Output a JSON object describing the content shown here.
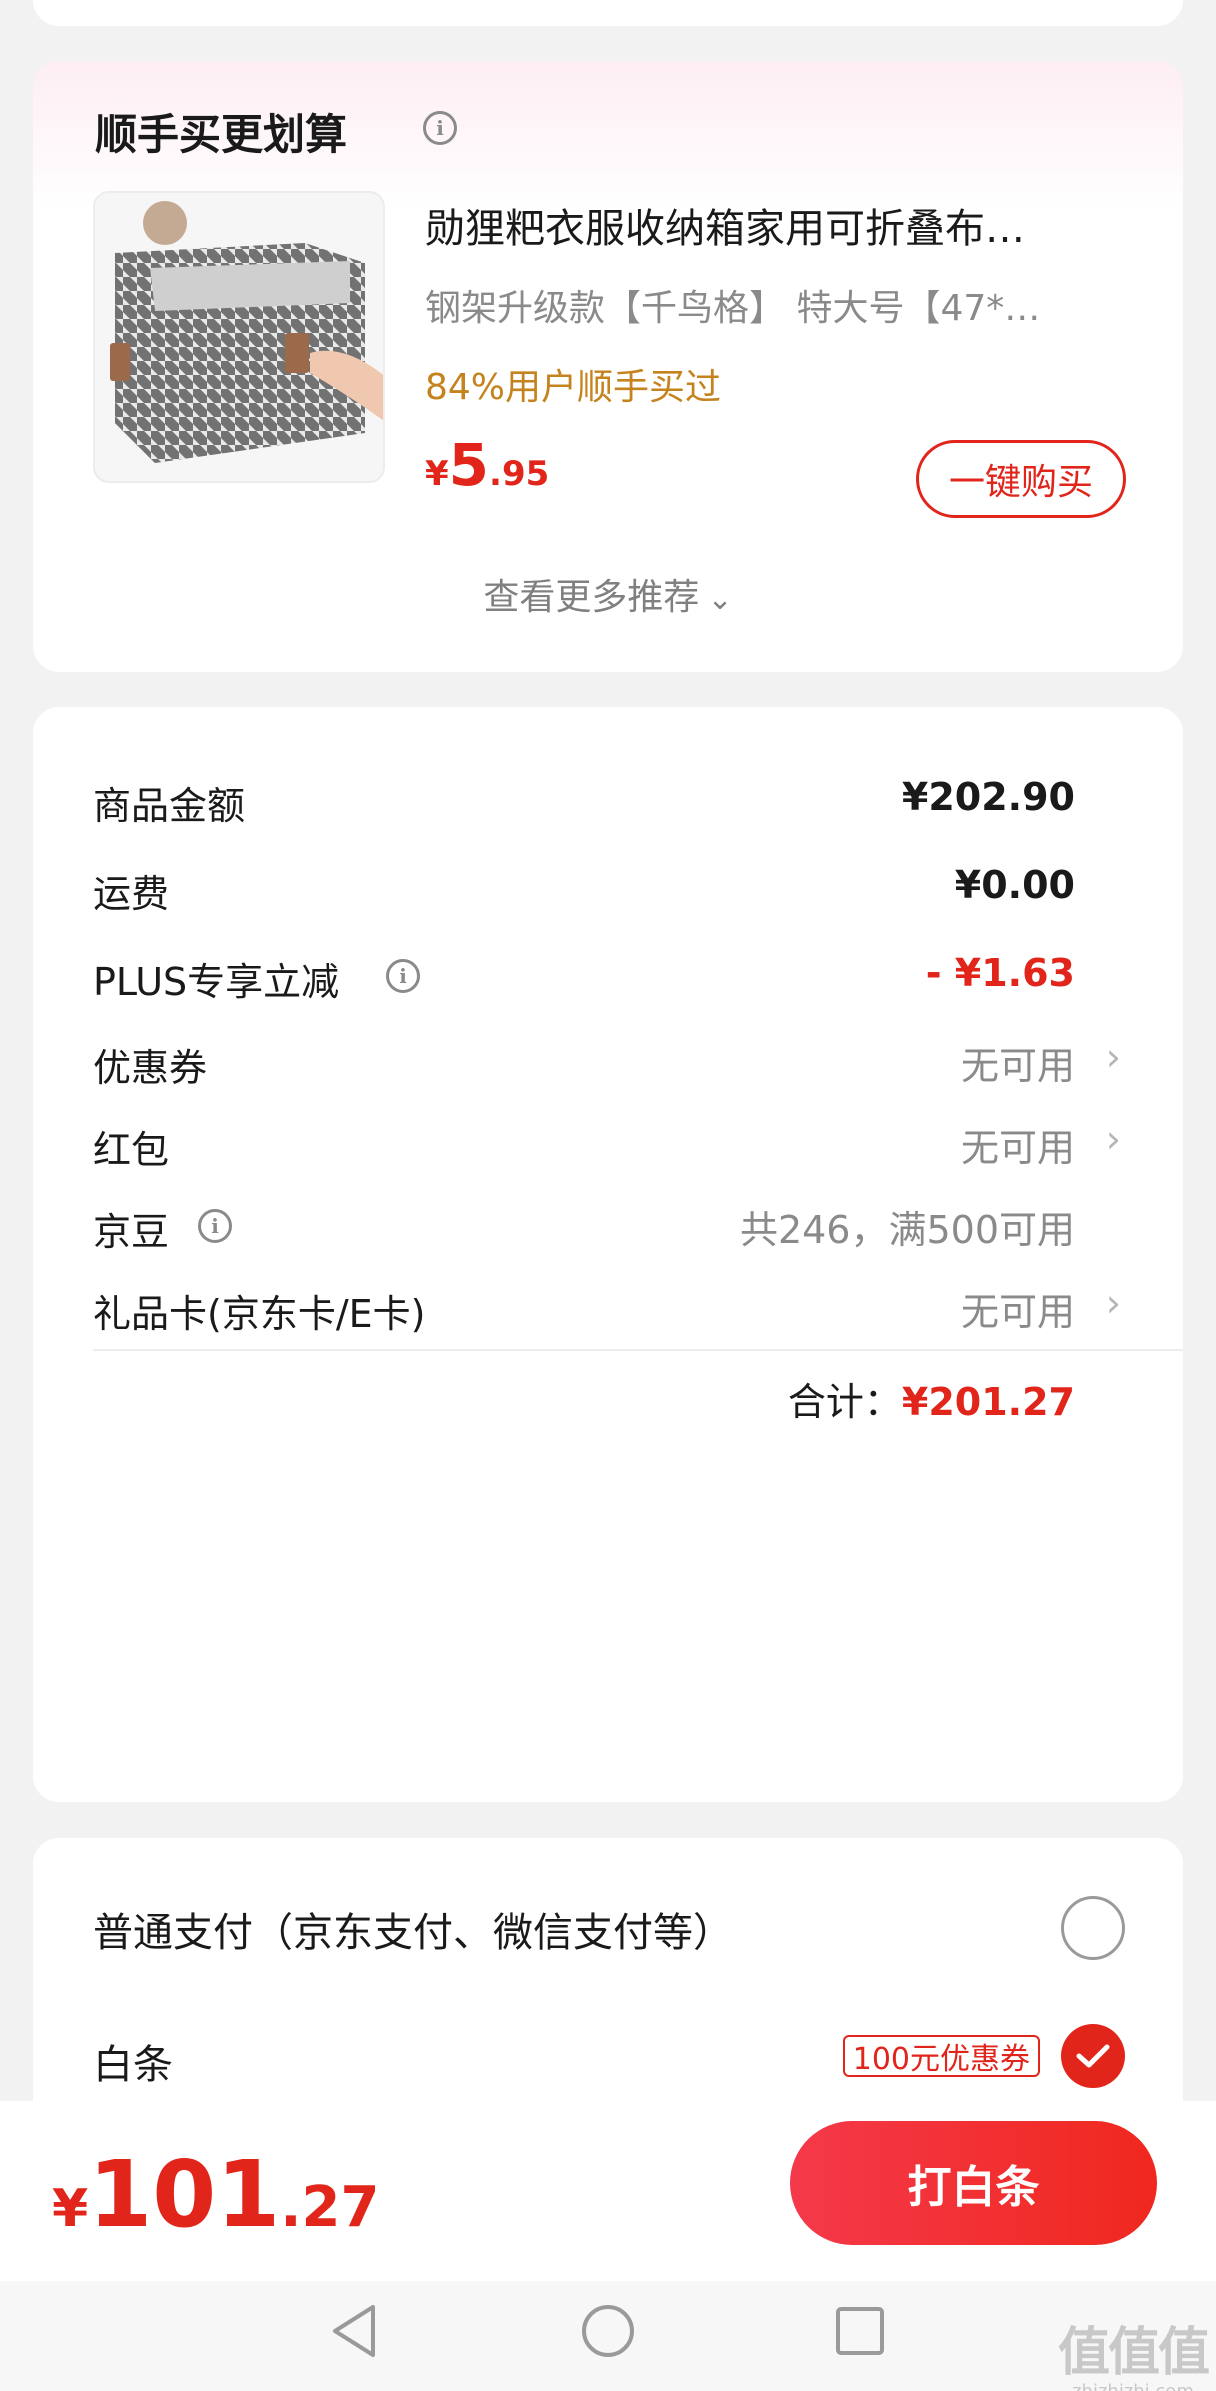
{
  "recommend": {
    "title": "顺手买更划算",
    "info_icon": "info-icon",
    "product": {
      "title": "勋狸粑衣服收纳箱家用可折叠布…",
      "spec": "钢架升级款【千鸟格】   特大号【47*…",
      "stat": "84%用户顺手买过",
      "price_symbol": "¥",
      "price_int": "5",
      "price_dec": ".95",
      "buy_label": "一键购买"
    },
    "more_label": "查看更多推荐"
  },
  "summary": {
    "rows": [
      {
        "label": "商品金额",
        "value": "¥202.90"
      },
      {
        "label": "运费",
        "value": "¥0.00"
      },
      {
        "label": "PLUS专享立减",
        "value": "- ¥1.63"
      },
      {
        "label": "优惠券",
        "value": "无可用"
      },
      {
        "label": "红包",
        "value": "无可用"
      },
      {
        "label": "京豆",
        "value": "共246，满500可用"
      },
      {
        "label": "礼品卡(京东卡/E卡)",
        "value": "无可用"
      }
    ],
    "total_label": "合计：",
    "total_value": "¥201.27"
  },
  "payment": {
    "options": [
      {
        "label": "普通支付（京东支付、微信支付等）",
        "selected": false
      },
      {
        "label": "白条",
        "selected": true,
        "badge": "100元优惠券"
      }
    ]
  },
  "footer": {
    "price_symbol": "¥",
    "price_int": "101",
    "price_dec": ".27",
    "pay_button": "打白条"
  },
  "watermark": {
    "main": "值值值",
    "sub": "zhizhizhi.com"
  },
  "colors": {
    "accent": "#e1251b",
    "stat": "#c5831e",
    "background": "#f2f2f2"
  }
}
